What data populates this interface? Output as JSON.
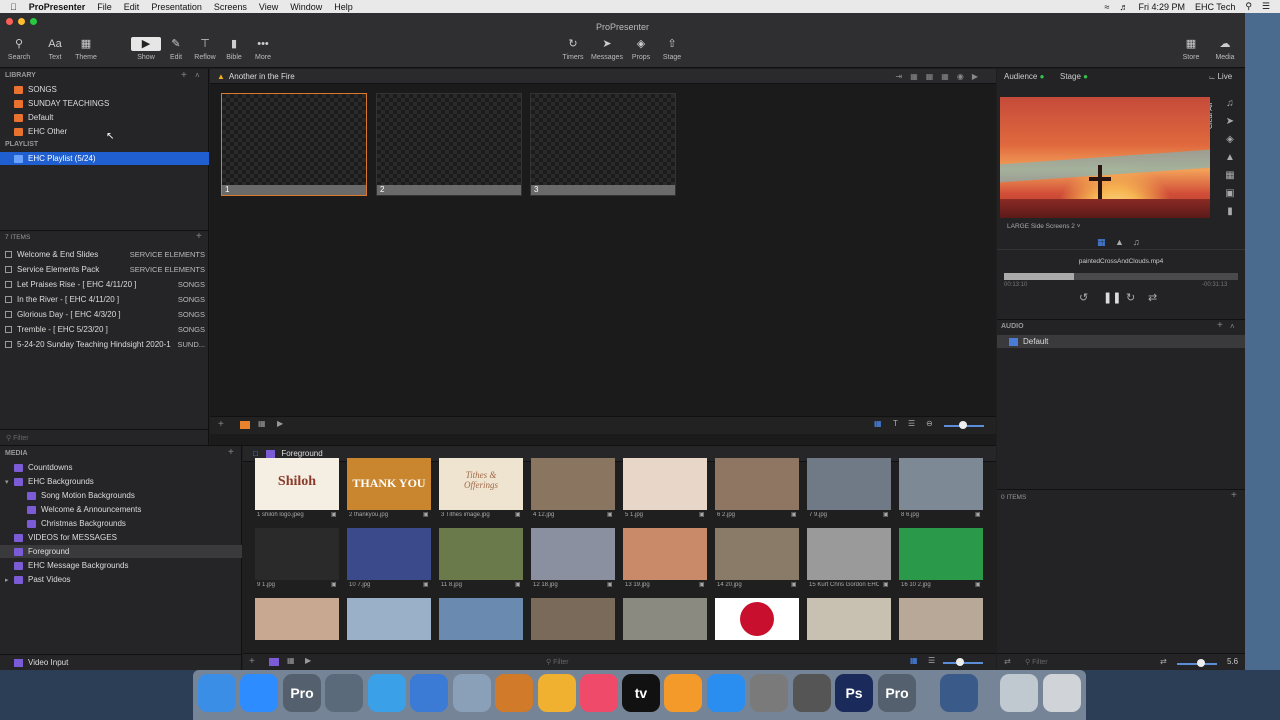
{
  "menubar": {
    "app": "ProPresenter",
    "items": [
      "File",
      "Edit",
      "Presentation",
      "Screens",
      "View",
      "Window",
      "Help"
    ],
    "clock": "Fri 4:29 PM",
    "user": "EHC Tech"
  },
  "window": {
    "title": "ProPresenter",
    "toolbar_left": [
      {
        "label": "Search",
        "icon": "search-icon"
      },
      {
        "label": "Text",
        "icon": "text-icon"
      },
      {
        "label": "Theme",
        "icon": "theme-icon"
      }
    ],
    "toolbar_mid": [
      {
        "label": "Show",
        "icon": "play-icon"
      },
      {
        "label": "Edit",
        "icon": "pencil-icon"
      },
      {
        "label": "Reflow",
        "icon": "reflow-icon"
      },
      {
        "label": "Bible",
        "icon": "bible-icon"
      },
      {
        "label": "More",
        "icon": "more-icon"
      }
    ],
    "toolbar_center": [
      {
        "label": "Timers",
        "icon": "timer-icon"
      },
      {
        "label": "Messages",
        "icon": "message-icon"
      },
      {
        "label": "Props",
        "icon": "layers-icon"
      },
      {
        "label": "Stage",
        "icon": "stage-icon"
      }
    ],
    "toolbar_right": [
      {
        "label": "Store",
        "icon": "store-icon"
      },
      {
        "label": "Media",
        "icon": "media-icon"
      }
    ]
  },
  "library": {
    "header": "LIBRARY",
    "items": [
      "SONGS",
      "SUNDAY TEACHINGS",
      "Default",
      "EHC Other"
    ],
    "playlist_header": "PLAYLIST",
    "playlist_item": "EHC Playlist (5/24)",
    "count": "7 ITEMS",
    "filter_placeholder": "Filter",
    "presentations": [
      {
        "name": "Welcome & End Slides",
        "cat": "SERVICE ELEMENTS"
      },
      {
        "name": "Service Elements Pack",
        "cat": "SERVICE ELEMENTS"
      },
      {
        "name": "Let Praises Rise - [ EHC 4/11/20 ]",
        "cat": "SONGS"
      },
      {
        "name": "In the River - [ EHC 4/11/20 ]",
        "cat": "SONGS"
      },
      {
        "name": "Glorious Day - [ EHC 4/3/20 ]",
        "cat": "SONGS"
      },
      {
        "name": "Tremble - [ EHC 5/23/20 ]",
        "cat": "SONGS"
      },
      {
        "name": "5-24-20 Sunday Teaching Hindsight 2020-1",
        "cat": "SUND..."
      }
    ]
  },
  "document": {
    "title": "Another in the Fire",
    "slides": [
      "1",
      "2",
      "3"
    ]
  },
  "output": {
    "audience": "Audience",
    "stage": "Stage",
    "live": "Live",
    "clear_all": "Clear All",
    "screen": "LARGE Side Screens 2",
    "file": "paintedCrossAndClouds.mp4",
    "time_elapsed": "00:13:10",
    "time_remaining": "-00:31:13",
    "progress": 0.3,
    "audio_header": "AUDIO",
    "audio_item": "Default",
    "items_count": "0 ITEMS",
    "filter_placeholder": "Filter"
  },
  "media": {
    "header": "MEDIA",
    "folder_header": "Foreground",
    "items": [
      {
        "label": "Countdowns",
        "indent": 0
      },
      {
        "label": "EHC Backgrounds",
        "indent": 0
      },
      {
        "label": "Song Motion Backgrounds",
        "indent": 1
      },
      {
        "label": "Welcome & Announcements",
        "indent": 1
      },
      {
        "label": "Christmas Backgrounds",
        "indent": 1
      },
      {
        "label": "VIDEOS for MESSAGES",
        "indent": 0
      },
      {
        "label": "Foreground",
        "indent": 0
      },
      {
        "label": "EHC Message Backgrounds",
        "indent": 0
      },
      {
        "label": "Past Videos",
        "indent": 0
      }
    ],
    "video_input": "Video Input",
    "thumbs": [
      "1 shiloh logo.jpeg",
      "2 thankyou.jpg",
      "3 Tithes image.jpg",
      "4 12.jpg",
      "5 1.jpg",
      "6 2.jpg",
      "7 9.jpg",
      "8 6.jpg",
      "9 1.jpg",
      "10 7.jpg",
      "11 8.jpg",
      "12 18.jpg",
      "13 19.jpg",
      "14 20.jpg",
      "15 Kurt Chris Gordon EHC",
      "16 10 2.jpg",
      "",
      "",
      "",
      "",
      "",
      "",
      "",
      ""
    ],
    "thumb_text": {
      "shiloh": "Shiloh",
      "thank": "THANK YOU",
      "tithes": "Tithes & Offerings"
    },
    "zoom": "5.6"
  },
  "dock": [
    "Finder",
    "Zoom",
    "Pro",
    "Launchpad",
    "Safari",
    "Keynote",
    "Preview",
    "GarageBand",
    "Photos",
    "Music",
    "TV",
    "Pages",
    "App Store",
    "Settings",
    "Blocked",
    "Ps",
    "Pro",
    "Chrome",
    "Files",
    "Trash"
  ]
}
